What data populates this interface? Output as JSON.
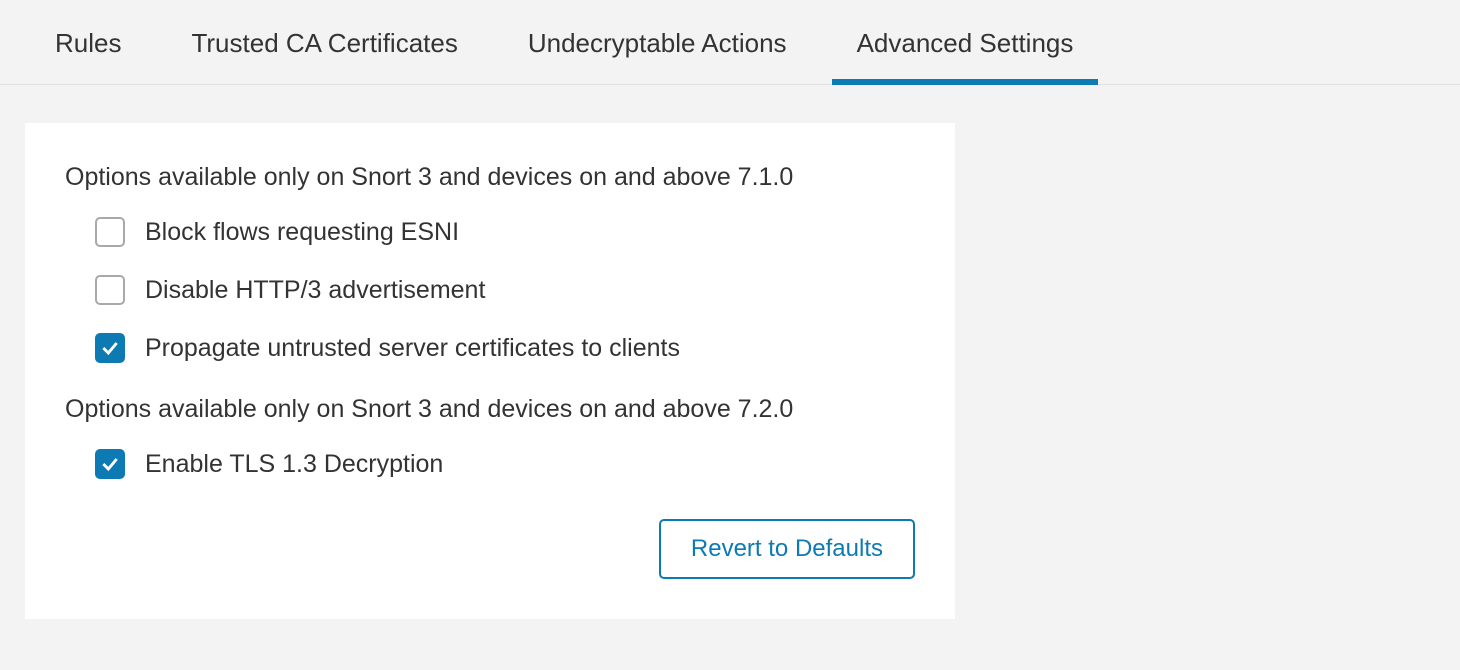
{
  "tabs": [
    {
      "label": "Rules",
      "active": false
    },
    {
      "label": "Trusted CA Certificates",
      "active": false
    },
    {
      "label": "Undecryptable Actions",
      "active": false
    },
    {
      "label": "Advanced Settings",
      "active": true
    }
  ],
  "panel": {
    "section1": {
      "heading": "Options available only on Snort 3 and devices on and above 7.1.0",
      "options": [
        {
          "label": "Block flows requesting ESNI",
          "checked": false
        },
        {
          "label": "Disable HTTP/3 advertisement",
          "checked": false
        },
        {
          "label": "Propagate untrusted server certificates to clients",
          "checked": true
        }
      ]
    },
    "section2": {
      "heading": "Options available only on Snort 3 and devices on and above 7.2.0",
      "options": [
        {
          "label": "Enable TLS 1.3 Decryption",
          "checked": true
        }
      ]
    },
    "revert_button": "Revert to Defaults"
  },
  "colors": {
    "accent": "#0d7ab3",
    "bg": "#f3f3f3"
  }
}
